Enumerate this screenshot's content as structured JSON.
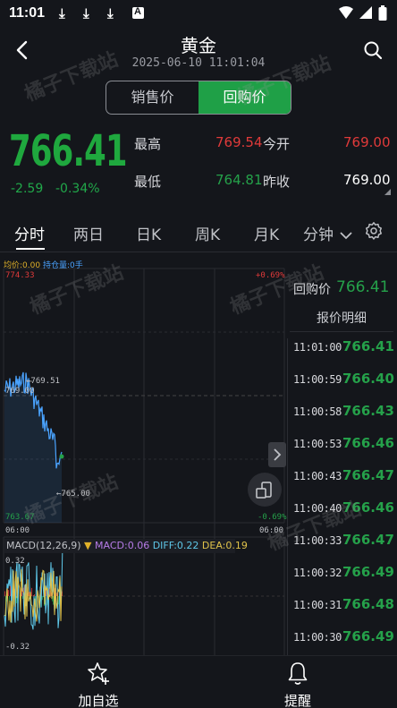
{
  "status_bar": {
    "time": "11:01"
  },
  "header": {
    "title": "黄金",
    "subtitle": "2025-06-10 11:01:04"
  },
  "toggle": {
    "sell_label": "销售价",
    "buy_label": "回购价",
    "active": "buy"
  },
  "quote": {
    "price": "766.41",
    "change": "-2.59",
    "change_pct": "-0.34%",
    "high_label": "最高",
    "high_value": "769.54",
    "open_label": "今开",
    "open_value": "769.00",
    "low_label": "最低",
    "low_value": "764.81",
    "prev_close_label": "昨收",
    "prev_close_value": "769.00"
  },
  "tabs": [
    {
      "label": "分时",
      "active": true
    },
    {
      "label": "两日"
    },
    {
      "label": "日K"
    },
    {
      "label": "周K"
    },
    {
      "label": "月K"
    },
    {
      "label": "分钟"
    }
  ],
  "chart": {
    "legend_avg": "均价:0.00",
    "legend_pos": "持仓量:0手",
    "y_top": "774.33",
    "y_top_pct": "+0.69%",
    "y_mid": "769.00",
    "y_bottom": "763.67",
    "y_bottom_pct": "-0.69%",
    "high_marker": "←769.51",
    "low_marker": "←765.00",
    "x_start": "06:00",
    "x_end": "06:00",
    "macd_name": "MACD(12,26,9)",
    "macd_value": "MACD:0.06",
    "diff_value": "DIFF:0.22",
    "dea_value": "DEA:0.19",
    "macd_axis_top": "0.32",
    "macd_axis_bottom": "-0.32"
  },
  "side_panel": {
    "price_label": "回购价",
    "price_value": "766.41",
    "detail_title": "报价明细",
    "ticks": [
      {
        "time": "11:01:00",
        "price": "766.41"
      },
      {
        "time": "11:00:59",
        "price": "766.40"
      },
      {
        "time": "11:00:58",
        "price": "766.43"
      },
      {
        "time": "11:00:53",
        "price": "766.46"
      },
      {
        "time": "11:00:43",
        "price": "766.47"
      },
      {
        "time": "11:00:40",
        "price": "766.46"
      },
      {
        "time": "11:00:33",
        "price": "766.47"
      },
      {
        "time": "11:00:32",
        "price": "766.49"
      },
      {
        "time": "11:00:31",
        "price": "766.48"
      },
      {
        "time": "11:00:30",
        "price": "766.49"
      }
    ]
  },
  "bottom_bar": {
    "add_watchlist": "加自选",
    "alert": "提醒"
  },
  "watermark": "橘子下载站",
  "colors": {
    "background": "#14161b",
    "up_red": "#e03a3a",
    "down_green": "#25a14a",
    "accent_green": "#1fa047",
    "price_line": "#4aa3ff"
  }
}
